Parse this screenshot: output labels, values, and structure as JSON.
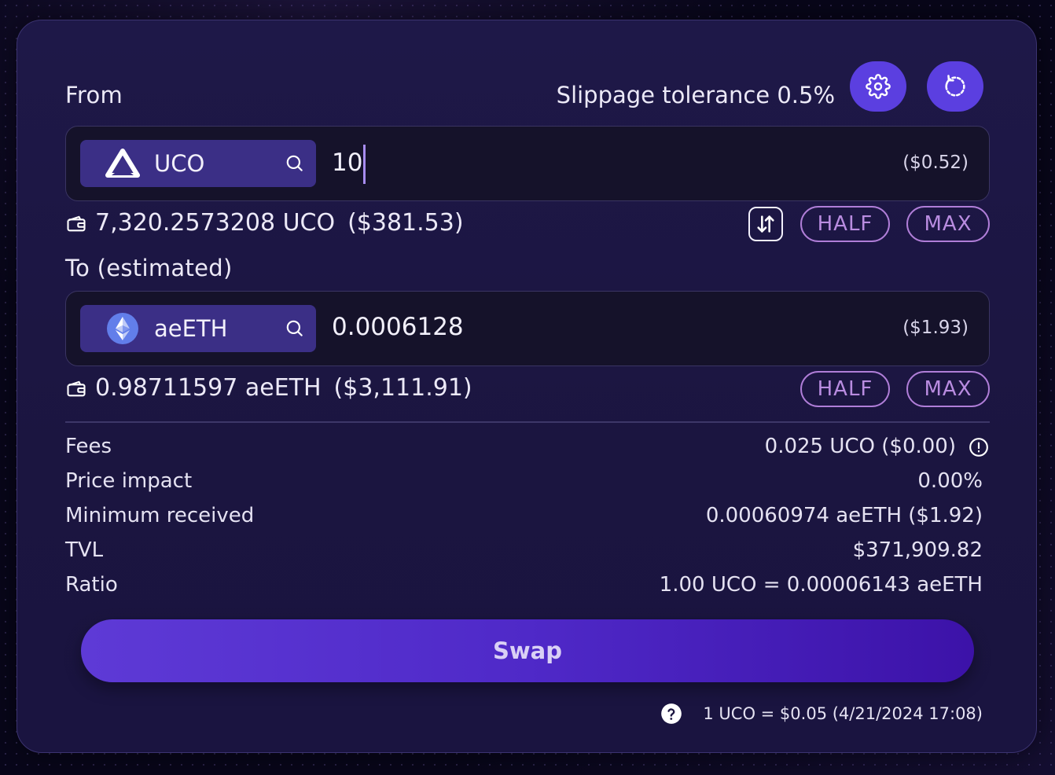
{
  "from": {
    "label": "From",
    "token": "UCO",
    "amount": "10",
    "usd": "($0.52)",
    "balance": "7,320.2573208 UCO",
    "balance_usd": "($381.53)",
    "half_label": "HALF",
    "max_label": "MAX"
  },
  "slippage": {
    "text": "Slippage tolerance 0.5%"
  },
  "to": {
    "label": "To (estimated)",
    "token": "aeETH",
    "amount": "0.0006128",
    "usd": "($1.93)",
    "balance": "0.98711597 aeETH",
    "balance_usd": "($3,111.91)",
    "half_label": "HALF",
    "max_label": "MAX"
  },
  "details": [
    {
      "label": "Fees",
      "value": "0.025 UCO  ($0.00)"
    },
    {
      "label": "Price impact",
      "value": "0.00%"
    },
    {
      "label": "Minimum received",
      "value": "0.00060974 aeETH  ($1.92)"
    },
    {
      "label": "TVL",
      "value": "$371,909.82"
    },
    {
      "label": "Ratio",
      "value": "1.00 UCO = 0.00006143 aeETH"
    }
  ],
  "swap_label": "Swap",
  "footer": {
    "price": "1 UCO = $0.05 (4/21/2024 17:08)"
  },
  "colors": {
    "accent": "#5b3fe0",
    "pill": "#b07ed8",
    "card": "#1e1848"
  },
  "icons": [
    "settings-icon",
    "refresh-icon",
    "search-icon",
    "wallet-icon",
    "swap-direction-icon",
    "info-icon",
    "help-icon",
    "archethic-logo-icon",
    "ethereum-logo-icon"
  ]
}
